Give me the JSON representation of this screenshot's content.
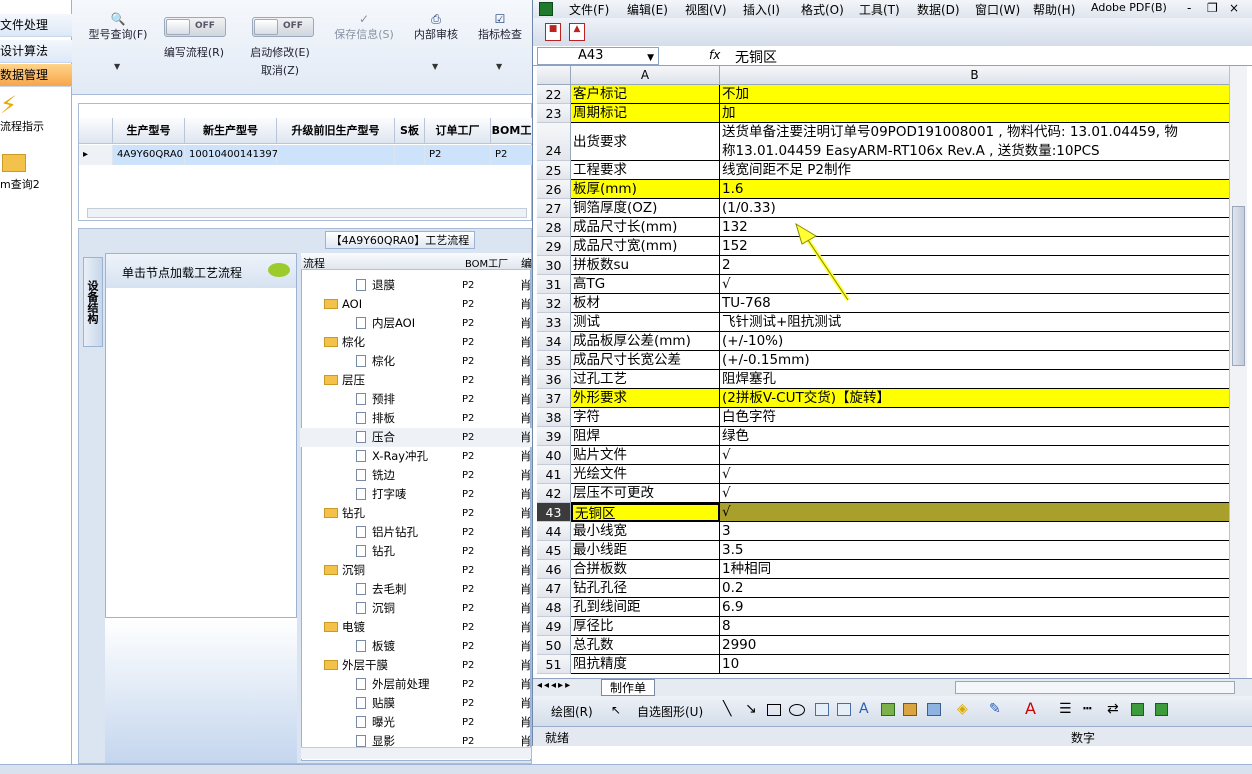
{
  "left_nav": {
    "items": [
      "文件处理",
      "设计算法",
      "数据管理"
    ],
    "tools": [
      "流程指示",
      "m查询2"
    ]
  },
  "toolbar": {
    "model_query": "型号查询(F)",
    "write_flow": "编写流程(R)",
    "start_modify": "启动修改(E)",
    "cancel": "取消(Z)",
    "save_info": "保存信息(S)",
    "internal_review": "内部审核",
    "index_check": "指标检查",
    "toggle_off": "OFF"
  },
  "grid": {
    "headers": [
      "生产型号",
      "新生产型号",
      "升级前旧生产型号",
      "S板",
      "订单工厂",
      "BOM工"
    ],
    "row": [
      "4A9Y60QRA0",
      "10010400141397",
      "",
      "",
      "P2",
      "P2"
    ]
  },
  "process": {
    "tab_title": "【4A9Y60QRA0】工艺流程",
    "vertical_tab": "设备结构",
    "left_panel_text": "单击节点加载工艺流程",
    "col_flow": "流程",
    "col_bom": "BOM工厂",
    "col_edit": "编",
    "rows": [
      {
        "name": "退膜",
        "type": "leaf",
        "f": "P2",
        "e": "肖"
      },
      {
        "name": "AOI",
        "type": "folder",
        "f": "P2",
        "e": "肖"
      },
      {
        "name": "内层AOI",
        "type": "leaf",
        "f": "P2",
        "e": "肖"
      },
      {
        "name": "棕化",
        "type": "folder",
        "f": "P2",
        "e": "肖"
      },
      {
        "name": "棕化",
        "type": "leaf",
        "f": "P2",
        "e": "肖"
      },
      {
        "name": "层压",
        "type": "folder",
        "f": "P2",
        "e": "肖"
      },
      {
        "name": "预排",
        "type": "leaf",
        "f": "P2",
        "e": "肖"
      },
      {
        "name": "排板",
        "type": "leaf",
        "f": "P2",
        "e": "肖"
      },
      {
        "name": "压合",
        "type": "leaf",
        "f": "P2",
        "e": "肖"
      },
      {
        "name": "X-Ray冲孔",
        "type": "leaf",
        "f": "P2",
        "e": "肖"
      },
      {
        "name": "铣边",
        "type": "leaf",
        "f": "P2",
        "e": "肖"
      },
      {
        "name": "打字唛",
        "type": "leaf",
        "f": "P2",
        "e": "肖"
      },
      {
        "name": "钻孔",
        "type": "folder",
        "f": "P2",
        "e": "肖"
      },
      {
        "name": "铝片钻孔",
        "type": "leaf",
        "f": "P2",
        "e": "肖"
      },
      {
        "name": "钻孔",
        "type": "leaf",
        "f": "P2",
        "e": "肖"
      },
      {
        "name": "沉铜",
        "type": "folder",
        "f": "P2",
        "e": "肖"
      },
      {
        "name": "去毛刺",
        "type": "leaf",
        "f": "P2",
        "e": "肖"
      },
      {
        "name": "沉铜",
        "type": "leaf",
        "f": "P2",
        "e": "肖"
      },
      {
        "name": "电镀",
        "type": "folder",
        "f": "P2",
        "e": "肖"
      },
      {
        "name": "板镀",
        "type": "leaf",
        "f": "P2",
        "e": "肖"
      },
      {
        "name": "外层干膜",
        "type": "folder",
        "f": "P2",
        "e": "肖"
      },
      {
        "name": "外层前处理",
        "type": "leaf",
        "f": "P2",
        "e": "肖"
      },
      {
        "name": "贴膜",
        "type": "leaf",
        "f": "P2",
        "e": "肖"
      },
      {
        "name": "曝光",
        "type": "leaf",
        "f": "P2",
        "e": "肖"
      },
      {
        "name": "显影",
        "type": "leaf",
        "f": "P2",
        "e": "肖"
      }
    ]
  },
  "excel": {
    "menus": [
      "文件(F)",
      "编辑(E)",
      "视图(V)",
      "插入(I)",
      "格式(O)",
      "工具(T)",
      "数据(D)",
      "窗口(W)",
      "帮助(H)",
      "Adobe PDF(B)"
    ],
    "name_box": "A43",
    "fx": "fx",
    "formula": "无铜区",
    "col_a": "A",
    "col_b": "B",
    "rows": [
      {
        "n": "22",
        "a": "客户标记",
        "b": "不加",
        "hl": "yel"
      },
      {
        "n": "23",
        "a": "周期标记",
        "b": "加",
        "hl": "yel"
      },
      {
        "n": "24",
        "a": "出货要求",
        "b": "送货单备注要注明订单号09POD191008001 , 物料代码: 13.01.04459, 物",
        "b2": "称13.01.04459  EasyARM-RT106x Rev.A , 送货数量:10PCS",
        "hl": ""
      },
      {
        "n": "25",
        "a": "工程要求",
        "b": "线宽间距不足 P2制作",
        "hl": ""
      },
      {
        "n": "26",
        "a": "板厚(mm)",
        "b": "1.6",
        "hl": "yel"
      },
      {
        "n": "27",
        "a": "铜箔厚度(OZ)",
        "b": " (1/0.33)",
        "hl": ""
      },
      {
        "n": "28",
        "a": "成品尺寸长(mm)",
        "b": "132",
        "hl": ""
      },
      {
        "n": "29",
        "a": "成品尺寸宽(mm)",
        "b": "152",
        "hl": ""
      },
      {
        "n": "30",
        "a": "拼板数su",
        "b": "2",
        "hl": ""
      },
      {
        "n": "31",
        "a": "高TG",
        "b": "√",
        "hl": ""
      },
      {
        "n": "32",
        "a": "板材",
        "b": "TU-768",
        "hl": ""
      },
      {
        "n": "33",
        "a": "测试",
        "b": "飞针测试+阻抗测试",
        "hl": ""
      },
      {
        "n": "34",
        "a": "成品板厚公差(mm)",
        "b": "(+/-10%)",
        "hl": ""
      },
      {
        "n": "35",
        "a": "成品尺寸长宽公差",
        "b": "(+/-0.15mm)",
        "hl": ""
      },
      {
        "n": "36",
        "a": "过孔工艺",
        "b": "阻焊塞孔",
        "hl": ""
      },
      {
        "n": "37",
        "a": "外形要求",
        "b": "(2拼板V-CUT交货)【旋转】",
        "hl": "yel"
      },
      {
        "n": "38",
        "a": "字符",
        "b": "白色字符",
        "hl": ""
      },
      {
        "n": "39",
        "a": "阻焊",
        "b": "绿色",
        "hl": ""
      },
      {
        "n": "40",
        "a": "贴片文件",
        "b": "√",
        "hl": ""
      },
      {
        "n": "41",
        "a": "光绘文件",
        "b": "√",
        "hl": ""
      },
      {
        "n": "42",
        "a": "层压不可更改",
        "b": "√",
        "hl": ""
      },
      {
        "n": "43",
        "a": "无铜区",
        "b": "√",
        "hl": "sel"
      },
      {
        "n": "44",
        "a": "最小线宽",
        "b": "3",
        "hl": ""
      },
      {
        "n": "45",
        "a": "最小线距",
        "b": "3.5",
        "hl": ""
      },
      {
        "n": "46",
        "a": "合拼板数",
        "b": "1种相同",
        "hl": ""
      },
      {
        "n": "47",
        "a": "钻孔孔径",
        "b": "0.2",
        "hl": ""
      },
      {
        "n": "48",
        "a": "孔到线间距",
        "b": "6.9",
        "hl": ""
      },
      {
        "n": "49",
        "a": "厚径比",
        "b": "8",
        "hl": ""
      },
      {
        "n": "50",
        "a": "总孔数",
        "b": "2990",
        "hl": ""
      },
      {
        "n": "51",
        "a": "阻抗精度",
        "b": "10",
        "hl": ""
      }
    ],
    "sheet_tab": "制作单",
    "draw_label": "绘图(R)",
    "autoshape": "自选图形(U)",
    "status_ready": "就绪",
    "status_num": "数字"
  },
  "colors": {
    "highlight": "#ffff00",
    "selected_row": "#a8a02a",
    "nav_active": "#f7a54a",
    "arrow": "#ffff33"
  }
}
